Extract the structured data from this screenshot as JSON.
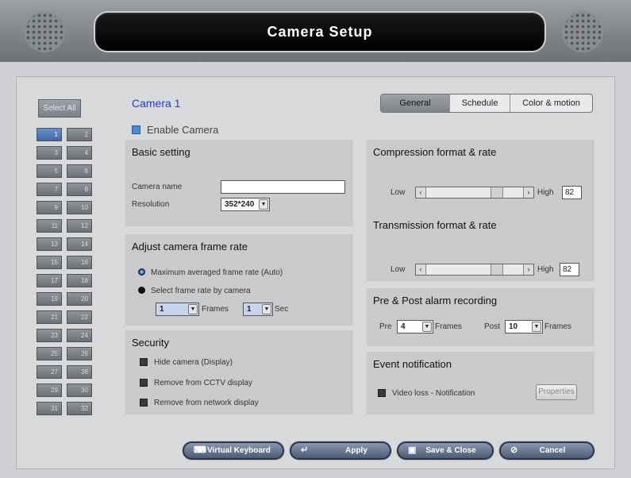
{
  "header": {
    "title": "Camera Setup"
  },
  "camera_list": {
    "select_all_label": "Select All",
    "selected": "1",
    "cameras": [
      "1",
      "2",
      "3",
      "4",
      "5",
      "6",
      "7",
      "8",
      "9",
      "10",
      "11",
      "12",
      "13",
      "14",
      "15",
      "16",
      "17",
      "18",
      "19",
      "20",
      "21",
      "22",
      "23",
      "24",
      "25",
      "26",
      "27",
      "28",
      "29",
      "30",
      "31",
      "32"
    ]
  },
  "camera": {
    "title": "Camera 1",
    "enable_label": "Enable Camera"
  },
  "tabs": [
    {
      "label": "General",
      "active": true
    },
    {
      "label": "Schedule",
      "active": false
    },
    {
      "label": "Color & motion",
      "active": false
    }
  ],
  "basic": {
    "title": "Basic setting",
    "camera_name_label": "Camera name",
    "camera_name_value": "",
    "resolution_label": "Resolution",
    "resolution_value": "352*240"
  },
  "frame_rate": {
    "title": "Adjust camera frame rate",
    "option_auto": "Maximum averaged frame rate (Auto)",
    "option_manual": "Select frame rate by camera",
    "frames_value": "1",
    "frames_label": "Frames",
    "sec_value": "1",
    "sec_label": "Sec"
  },
  "security": {
    "title": "Security",
    "items": [
      "Hide camera (Display)",
      "Remove from CCTV display",
      "Remove from network display"
    ]
  },
  "compression": {
    "title": "Compression format & rate",
    "low_label": "Low",
    "high_label": "High",
    "value": "82"
  },
  "transmission": {
    "title": "Transmission format & rate",
    "low_label": "Low",
    "high_label": "High",
    "value": "82"
  },
  "prepost": {
    "title": "Pre & Post alarm recording",
    "pre_label": "Pre",
    "pre_value": "4",
    "pre_unit": "Frames",
    "post_label": "Post",
    "post_value": "10",
    "post_unit": "Frames"
  },
  "event": {
    "title": "Event notification",
    "item_label": "Video loss - Notification",
    "properties_label": "Properties"
  },
  "footer": {
    "keyboard_label": "Virtual Keyboard",
    "apply_label": "Apply",
    "save_close_label": "Save & Close",
    "cancel_label": "Cancel"
  }
}
